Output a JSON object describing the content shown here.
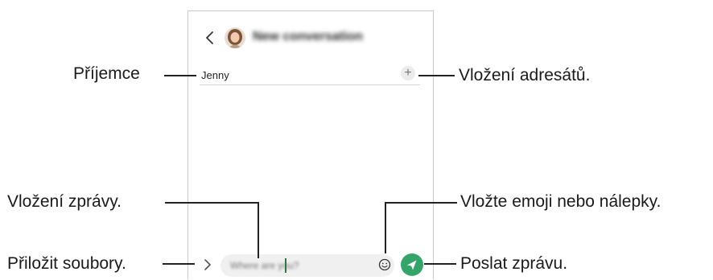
{
  "conversation": {
    "title": "New conversation",
    "recipient": "Jenny",
    "add_symbol": "+",
    "message_draft": "Where are you?"
  },
  "callouts": {
    "recipient": "Příjemce",
    "add_recipients": "Vložení adresátů.",
    "enter_message": "Vložení zprávy.",
    "emoji_stickers": "Vložte emoji nebo nálepky.",
    "attach_files": "Přiložit soubory.",
    "send_message": "Poslat zprávu."
  },
  "colors": {
    "send_accent": "#35a468",
    "callout_text": "#1a1a1a"
  },
  "icons": [
    "back-icon",
    "avatar",
    "plus-icon",
    "chevron-right-icon",
    "emoji-icon",
    "send-icon"
  ]
}
